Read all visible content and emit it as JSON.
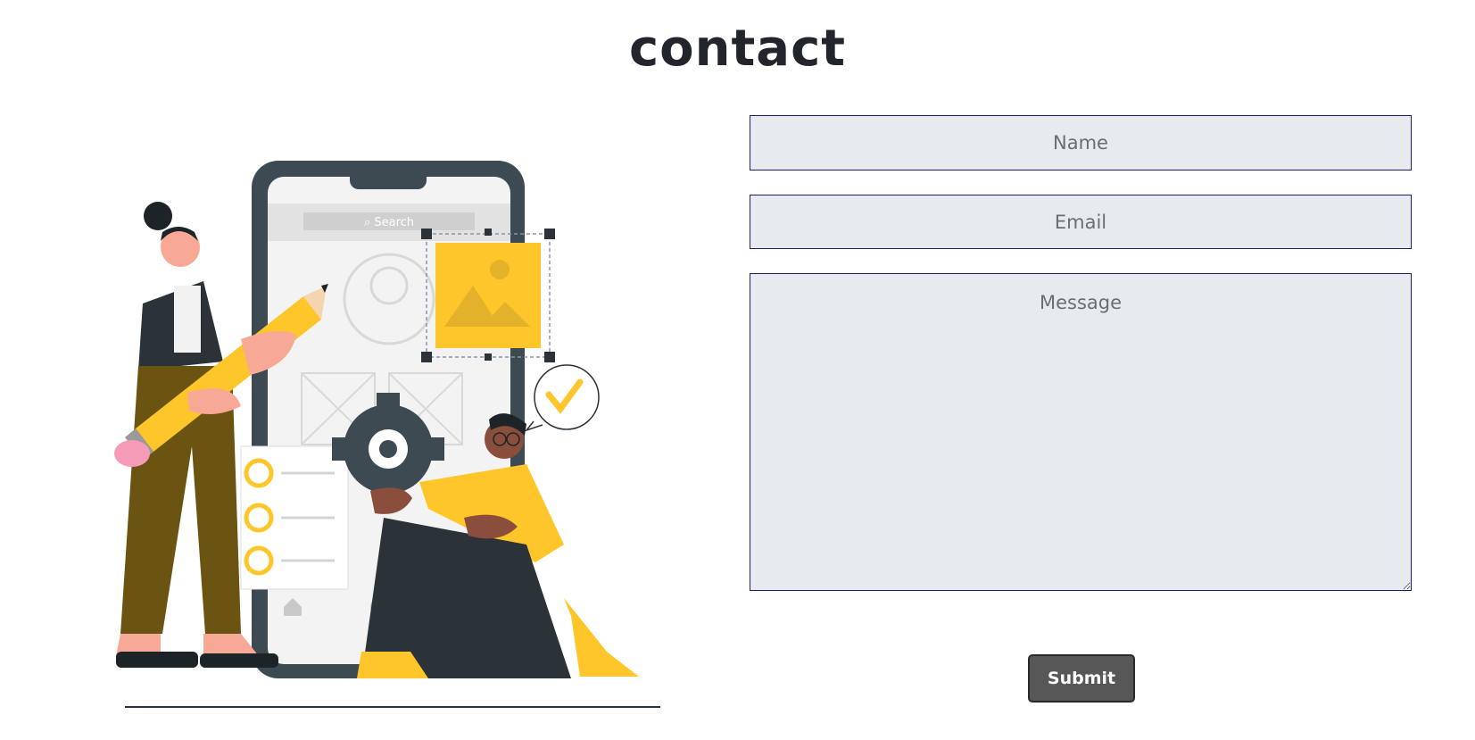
{
  "page": {
    "title": "contact"
  },
  "form": {
    "name_placeholder": "Name",
    "email_placeholder": "Email",
    "message_placeholder": "Message",
    "submit_label": "Submit"
  },
  "illustration": {
    "search_label": "Search"
  },
  "colors": {
    "accent_yellow": "#fec62a",
    "dark": "#2b3338",
    "field_bg": "#e7ebef",
    "field_border": "#1c1f6e",
    "button_bg": "#575757"
  }
}
